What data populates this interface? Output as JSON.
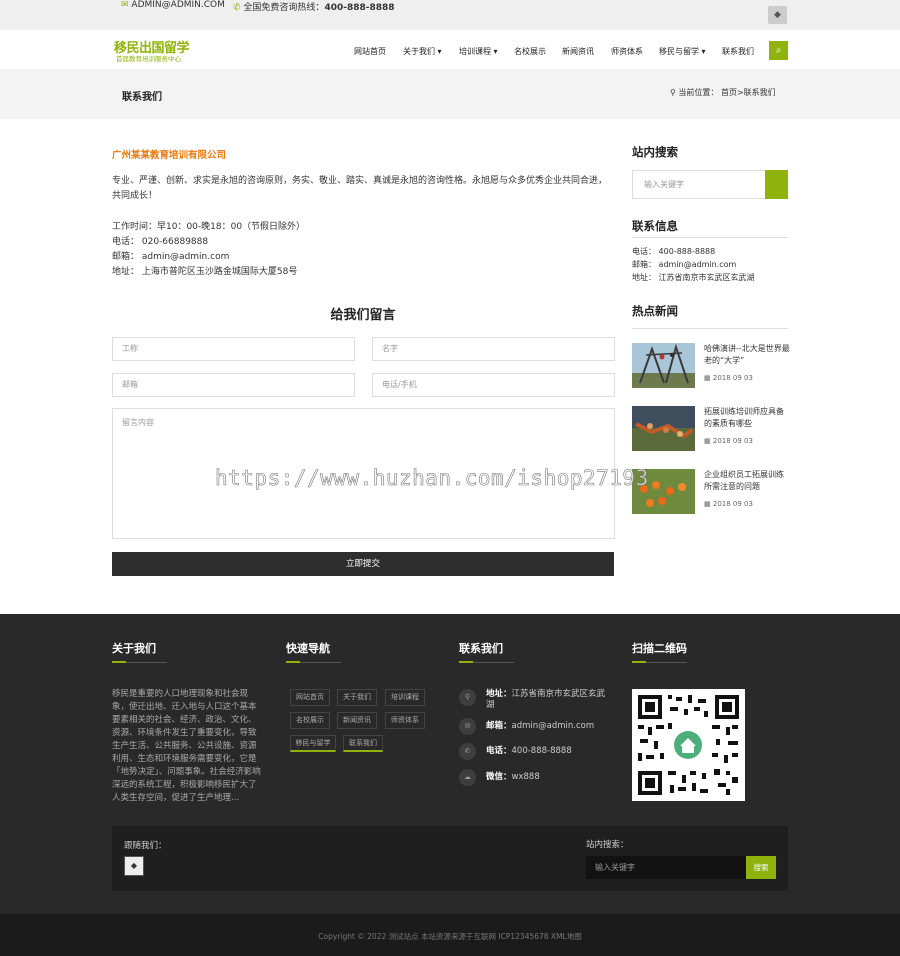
{
  "topbar": {
    "email": "ADMIN@ADMIN.COM",
    "hotline_label": "全国免费咨询热线：",
    "hotline": "400-888-8888"
  },
  "header": {
    "logo_title": "移民出国留学",
    "logo_sub": "首届教育培训服务中心",
    "nav": [
      "网站首页",
      "关于我们 ▾",
      "培训课程 ▾",
      "名校展示",
      "新闻资讯",
      "师资体系",
      "移民与留学 ▾",
      "联系我们"
    ]
  },
  "crumb": {
    "title": "联系我们",
    "loc_label": "当前位置：",
    "path": "首页>联系我们"
  },
  "contact": {
    "company": "广州某某教育培训有限公司",
    "intro": "专业、严谨、创新、求实是永旭的咨询原则，务实、敬业、踏实、真诚是永旭的咨询性格。永旭愿与众多优秀企业共同合进，共同成长！",
    "hours": "工作时间：早10：00-晚18：00（节假日除外）",
    "phone": "电话：  020-66889888",
    "email": "邮箱：  admin@admin.com",
    "address": "地址：  上海市普陀区玉沙路金城国际大厦58号"
  },
  "form": {
    "title": "给我们留言",
    "company_placeholder": "工称",
    "name_placeholder": "名字",
    "email_placeholder": "邮箱",
    "phone_placeholder": "电话/手机",
    "content_placeholder": "留言内容",
    "submit": "立即提交"
  },
  "sidebar": {
    "search_title": "站内搜索",
    "search_placeholder": "输入关键字",
    "contact_title": "联系信息",
    "contact_phone": "电话：  400-888-8888",
    "contact_email": "邮箱：  admin@admin.com",
    "contact_address": "地址：  江苏省南京市玄武区玄武湖",
    "news_title": "热点新闻",
    "news": [
      {
        "title": "哈佛演讲--北大是世界最老的“大学”",
        "date": "2018 09 03"
      },
      {
        "title": "拓展训练培训师应具备的素质有哪些",
        "date": "2018 09 03"
      },
      {
        "title": "企业组织员工拓展训练所需注意的问题",
        "date": "2018 09 03"
      }
    ]
  },
  "footer": {
    "about_title": "关于我们",
    "about_text": "移民是重要的人口地理现象和社会现象，使迁出地、迁入地与人口这个基本要素相关的社会、经济、政治、文化、资源、环境条件发生了重要变化，导致生产生活、公共服务、公共设施、资源利用、生态和环境服务需要变化，它是「地势决定」、问题事象。社会经济影响深远的系统工程，积极影响移民扩大了人类生存空间，促进了生产地理...",
    "nav_title": "快速导航",
    "nav_links": [
      "网站首页",
      "关于我们",
      "培训课程",
      "名校展示",
      "新闻资讯",
      "师资体系",
      "移民与留学",
      "联系我们"
    ],
    "contact_title": "联系我们",
    "address_label": "地址：",
    "address": "江苏省南京市玄武区玄武湖",
    "email_label": "邮箱：",
    "email": "admin@admin.com",
    "phone_label": "电话：",
    "phone": "400-888-8888",
    "wechat_label": "微信：",
    "wechat": "wx888",
    "qr_title": "扫描二维码",
    "follow_label": "跟随我们：",
    "search_label": "站内搜索：",
    "search_placeholder": "输入关键字",
    "search_button": "搜索",
    "copyright": "Copyright © 2022 测试站点 本站资源来源于互联网 ICP12345678 XML地图"
  },
  "watermark": "https://www.huzhan.com/ishop27193",
  "colors": {
    "accent": "#8fb20c",
    "company": "#e87a12",
    "footer_bg": "#292929"
  }
}
